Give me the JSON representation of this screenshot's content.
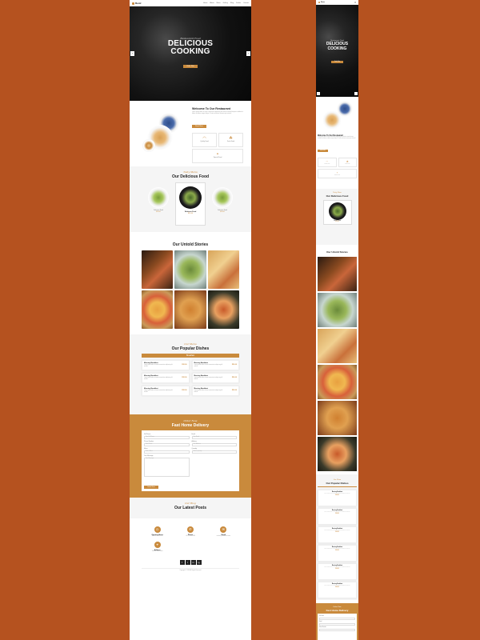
{
  "brand": {
    "name": "Restr",
    "accent": "#c98a3c",
    "bg": "#b5521f"
  },
  "nav": {
    "items": [
      "Home",
      "About",
      "Menu",
      "Gallery",
      "Blog",
      "Dishes",
      "Contact"
    ],
    "menu_icon": "hamburger-icon"
  },
  "hero": {
    "subtitle": "Restaurant Food",
    "title_line1": "DELICIOUS",
    "title_line2": "COOKING",
    "button": "Order Now",
    "prev_icon": "chevron-left-icon",
    "next_icon": "chevron-right-icon"
  },
  "welcome": {
    "title": "Welcome To Our Restaurant",
    "text": "Lorem ipsum dolor sit amet consectetur adipiscing elit sed do eiusmod tempor incididunt ut labore et dolore magna aliqua. Ut enim ad minim veniam quis nostrud.",
    "button": "Read More",
    "features": [
      {
        "label": "Quality Food",
        "icon": "plate-icon"
      },
      {
        "label": "Fresh Food",
        "icon": "leaf-icon"
      },
      {
        "label": "Special Food",
        "icon": "cloche-icon"
      }
    ]
  },
  "delicious": {
    "subtitle": "Tasty Menu",
    "title": "Our Delicious Food",
    "items": [
      {
        "name": "Delicious Food",
        "price": "$20.00"
      },
      {
        "name": "Delicious Food",
        "price": "$20.00"
      },
      {
        "name": "Delicious Food",
        "price": "$20.00"
      }
    ]
  },
  "stories": {
    "title": "Our Untold Stories"
  },
  "popular": {
    "subtitle": "Our Menu",
    "title": "Our Popular Dishes",
    "tab": "Breakfast",
    "dishes": [
      {
        "name": "Morning Breakfast",
        "desc": "Lorem ipsum dolor sit amet consectetur adipiscing elit sed do.",
        "price": "$20.00"
      },
      {
        "name": "Morning Breakfast",
        "desc": "Lorem ipsum dolor sit amet consectetur adipiscing elit sed do.",
        "price": "$20.00"
      },
      {
        "name": "Morning Breakfast",
        "desc": "Lorem ipsum dolor sit amet consectetur adipiscing elit sed do.",
        "price": "$20.00"
      },
      {
        "name": "Morning Breakfast",
        "desc": "Lorem ipsum dolor sit amet consectetur adipiscing elit sed do.",
        "price": "$20.00"
      },
      {
        "name": "Morning Breakfast",
        "desc": "Lorem ipsum dolor sit amet consectetur adipiscing elit sed do.",
        "price": "$20.00"
      },
      {
        "name": "Morning Breakfast",
        "desc": "Lorem ipsum dolor sit amet consectetur adipiscing elit sed do.",
        "price": "$20.00"
      }
    ]
  },
  "delivery": {
    "subtitle": "Order Now",
    "title": "Fast Home Delivery",
    "fields": {
      "full_name": "Full Name",
      "full_name_ph": "Your Full Name",
      "email": "Email",
      "email_ph": "Your Email",
      "phone": "Phone Number",
      "phone_ph": "Your Phone",
      "address": "Address",
      "address_ph": "Your Address",
      "menu": "Menu",
      "menu_ph": "Select Menu",
      "quantity": "Quantity",
      "quantity_ph": "Select Quantity",
      "message": "Your Message",
      "message_ph": "Your Message"
    },
    "button": "Order Now"
  },
  "posts": {
    "subtitle": "Our Blog",
    "title": "Our Latest Posts"
  },
  "contact": [
    {
      "title": "Opening Hours",
      "value": "Mon-Fri 9.00-22.00",
      "icon": "clock-icon"
    },
    {
      "title": "Phone",
      "value": "+61 3 8376 6284",
      "icon": "phone-icon"
    },
    {
      "title": "Email",
      "value": "contact@restaurant.com",
      "icon": "envelope-icon"
    },
    {
      "title": "Address",
      "value": "Victoria, Melbourne",
      "icon": "map-pin-icon"
    }
  ],
  "social": [
    {
      "glyph": "f",
      "icon": "facebook-icon"
    },
    {
      "glyph": "t",
      "icon": "twitter-icon"
    },
    {
      "glyph": "in",
      "icon": "linkedin-icon"
    },
    {
      "glyph": "ig",
      "icon": "instagram-icon"
    }
  ],
  "footer": {
    "copyright": "Copyright © 2020 All Rights Reserved"
  }
}
